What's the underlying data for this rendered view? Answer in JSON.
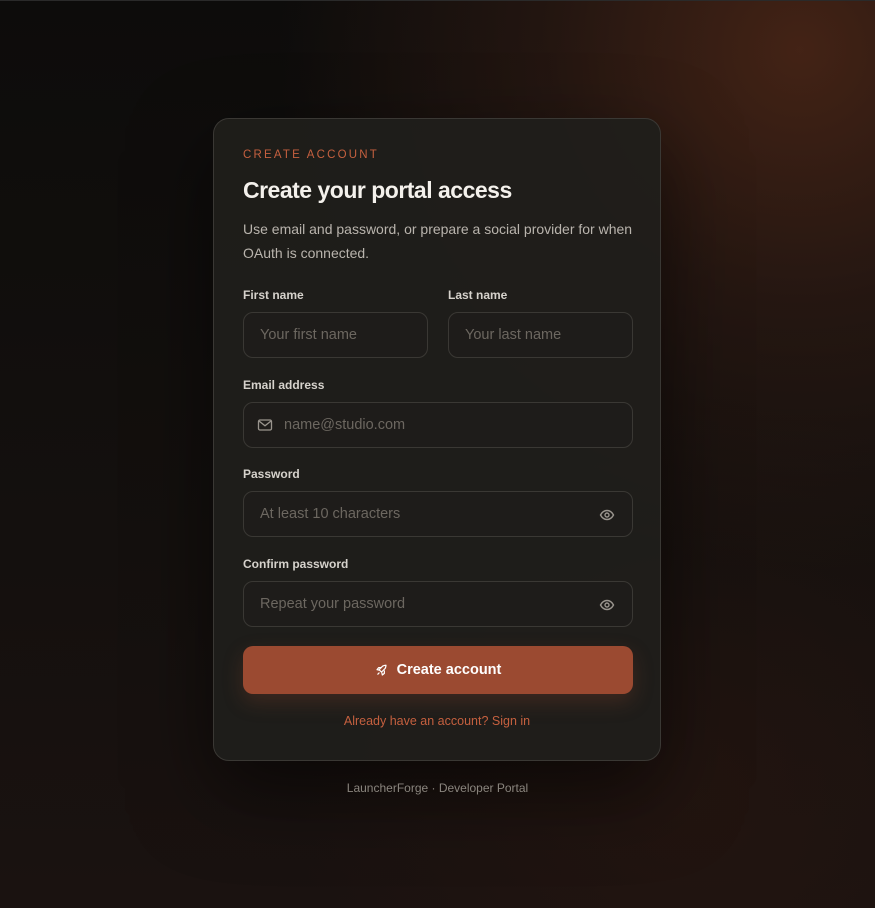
{
  "form": {
    "eyebrow": "CREATE ACCOUNT",
    "title": "Create your portal access",
    "subtitle": "Use email and password, or prepare a social provider for when OAuth is connected.",
    "first_name": {
      "label": "First name",
      "placeholder": "Your first name",
      "value": ""
    },
    "last_name": {
      "label": "Last name",
      "placeholder": "Your last name",
      "value": ""
    },
    "email": {
      "label": "Email address",
      "placeholder": "name@studio.com",
      "value": "",
      "icon": "mail-icon"
    },
    "password": {
      "label": "Password",
      "placeholder": "At least 10 characters",
      "value": "",
      "icon": "eye-icon"
    },
    "confirm_password": {
      "label": "Confirm password",
      "placeholder": "Repeat your password",
      "value": "",
      "icon": "eye-icon"
    },
    "submit_label": "Create account",
    "submit_icon": "rocket-icon",
    "signin_link": "Already have an account? Sign in"
  },
  "footer": {
    "text": "LauncherForge · Developer Portal"
  },
  "colors": {
    "accent": "#c5603f",
    "button": "#9b4a31",
    "card": "#201e1b",
    "background": "#0d0c0b"
  }
}
